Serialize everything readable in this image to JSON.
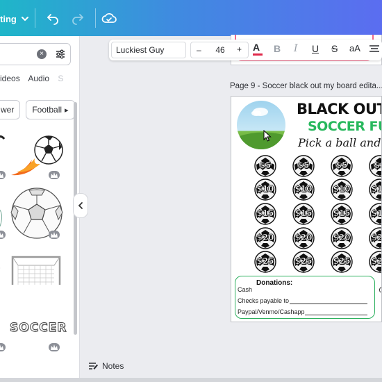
{
  "header": {
    "editing_label": "ting",
    "icons": [
      "chevron-down-icon",
      "undo-icon",
      "redo-icon",
      "cloud-save-icon"
    ]
  },
  "side_panel": {
    "search_placeholder": "",
    "tabs": [
      "ideos",
      "Audio",
      "S"
    ],
    "chips": [
      "wer",
      "Football"
    ],
    "results": [
      "flaming-soccer-ball",
      "sketched-soccer-ball",
      "soccer-goal",
      "soccer-word-art"
    ]
  },
  "text_toolbar": {
    "font_name": "Luckiest Guy",
    "font_size": "46",
    "minus": "–",
    "plus": "+",
    "buttons": [
      "text-color",
      "bold",
      "italic",
      "underline",
      "strikethrough",
      "case",
      "align"
    ],
    "text_color": "#e0294a"
  },
  "canvas": {
    "page_label": "Page 9 - Soccer black out my board edita...",
    "flyer": {
      "title_line1": "BLACK OUT",
      "title_line2": "SOCCER FU",
      "title_line3": "Pick a ball and p",
      "amount_rows": [
        "$5",
        "$10",
        "$15",
        "$20",
        "$25"
      ],
      "donations_title": "Donations:",
      "donation_lines": [
        "Cash",
        "Checks payable to",
        "Paypal/Venmo/Cashapp"
      ]
    }
  },
  "footer": {
    "notes_label": "Notes"
  },
  "colors": {
    "header_gradient_start": "#1fb6c9",
    "header_gradient_end": "#5b6df0",
    "flyer_green": "#27b85d",
    "donation_border": "#2bb05d"
  }
}
